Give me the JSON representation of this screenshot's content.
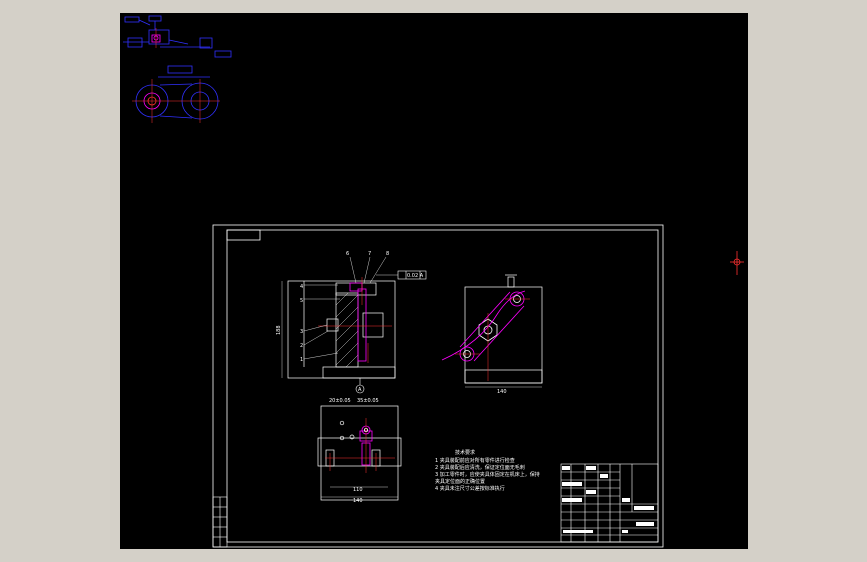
{
  "viewport": {
    "background_color": "#000000",
    "frame_color": "#d4d0c8"
  },
  "colors": {
    "line": "#ffffff",
    "part_blue": "#3030ff",
    "part_magenta": "#ff00ff",
    "part_red": "#ff3030",
    "center_line": "#ff2020"
  },
  "drawing": {
    "dimensions": {
      "front_height": "188",
      "side_width": "140",
      "bottom_inner": "110",
      "bottom_outer": "140",
      "bore_1": "20±0.05",
      "bore_2": "35±0.05"
    },
    "tolerance_frame": "0.02 A",
    "datum_label": "A",
    "notes_title": "技术要求",
    "notes": [
      "1  夹具装配前应对所有零件进行检查",
      "2  夹具装配后应清洗，保证定位面无毛刺",
      "3  加工零件时，应使夹具体固定在机床上，保持",
      "    夹具定位面的正确位置",
      "4  夹具未注尺寸公差按标准执行"
    ]
  }
}
